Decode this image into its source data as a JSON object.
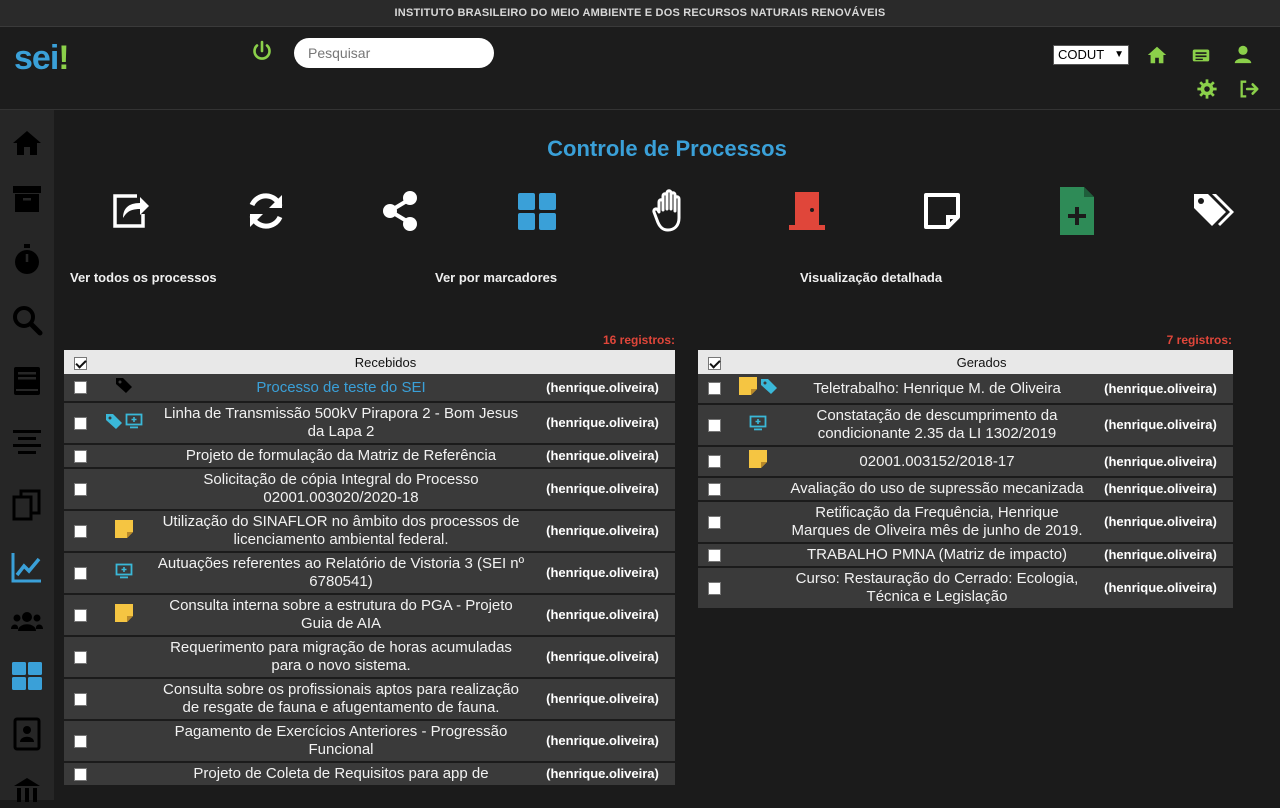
{
  "topbar": {
    "institution": "INSTITUTO BRASILEIRO DO MEIO AMBIENTE E DOS RECURSOS NATURAIS RENOVÁVEIS"
  },
  "header": {
    "logo_text": "sei",
    "logo_mark": "!",
    "search_placeholder": "Pesquisar",
    "unit_selected": "CODUT",
    "icons": [
      "power-icon",
      "home-icon",
      "list-icon",
      "user-icon",
      "gear-icon",
      "logout-icon"
    ]
  },
  "colors": {
    "accent_blue": "#3aa0d8",
    "accent_green": "#8bd04a",
    "alert_red": "#e0463a",
    "note_yellow": "#f5c542",
    "doc_green": "#2e8b57"
  },
  "sidebar": {
    "icons": [
      "home-icon",
      "archive-icon",
      "stopwatch-icon",
      "search-icon",
      "book-icon",
      "align-icon",
      "copy-icon",
      "chart-icon",
      "users-icon",
      "grid-icon",
      "contacts-icon",
      "building-icon"
    ]
  },
  "main": {
    "title": "Controle de Processos",
    "actions": [
      "share-out-icon",
      "refresh-icon",
      "share-nodes-icon",
      "panels-icon",
      "hand-icon",
      "door-icon",
      "note-icon",
      "new-doc-icon",
      "tags-icon"
    ],
    "filters": {
      "all": "Ver todos os processos",
      "markers": "Ver por marcadores",
      "detailed": "Visualização detalhada"
    },
    "received": {
      "count": "16 registros:",
      "header": "Recebidos",
      "rows": [
        {
          "title": "Processo de teste do SEI",
          "user": "(henrique.oliveira)",
          "icons": [
            "tag-dark"
          ],
          "link": true
        },
        {
          "title": "Linha de Transmissão 500kV Pirapora 2 - Bom Jesus da Lapa 2",
          "user": "(henrique.oliveira)",
          "icons": [
            "tag-blue",
            "monitor"
          ]
        },
        {
          "title": "Projeto de formulação da Matriz de Referência",
          "user": "(henrique.oliveira)",
          "icons": []
        },
        {
          "title": "Solicitação de cópia Integral do Processo 02001.003020/2020-18",
          "user": "(henrique.oliveira)",
          "icons": []
        },
        {
          "title": "Utilização do SINAFLOR no âmbito dos processos de licenciamento ambiental federal.",
          "user": "(henrique.oliveira)",
          "icons": [
            "note"
          ]
        },
        {
          "title": "Autuações referentes ao Relatório de Vistoria 3 (SEI nº 6780541)",
          "user": "(henrique.oliveira)",
          "icons": [
            "monitor"
          ]
        },
        {
          "title": "Consulta interna sobre a estrutura do PGA - Projeto Guia de AIA",
          "user": "(henrique.oliveira)",
          "icons": [
            "note"
          ]
        },
        {
          "title": "Requerimento para migração de horas acumuladas para o novo sistema.",
          "user": "(henrique.oliveira)",
          "icons": []
        },
        {
          "title": "Consulta sobre os profissionais aptos para realização de resgate de fauna e afugentamento de fauna.",
          "user": "(henrique.oliveira)",
          "icons": []
        },
        {
          "title": "Pagamento de Exercícios Anteriores - Progressão Funcional",
          "user": "(henrique.oliveira)",
          "icons": []
        },
        {
          "title": "Projeto de Coleta de Requisitos para app de",
          "user": "(henrique.oliveira)",
          "icons": []
        }
      ]
    },
    "generated": {
      "count": "7 registros:",
      "header": "Gerados",
      "rows": [
        {
          "title": "Teletrabalho: Henrique M. de Oliveira",
          "user": "(henrique.oliveira)",
          "icons": [
            "note",
            "tag-blue"
          ]
        },
        {
          "title": "Constatação de descumprimento da condicionante 2.35 da LI 1302/2019",
          "user": "(henrique.oliveira)",
          "icons": [
            "monitor"
          ]
        },
        {
          "title": "02001.003152/2018-17",
          "user": "(henrique.oliveira)",
          "icons": [
            "note"
          ]
        },
        {
          "title": "Avaliação do uso de supressão mecanizada",
          "user": "(henrique.oliveira)",
          "icons": []
        },
        {
          "title": "Retificação da Frequência, Henrique Marques de Oliveira mês de junho de 2019.",
          "user": "(henrique.oliveira)",
          "icons": []
        },
        {
          "title": "TRABALHO PMNA (Matriz de impacto)",
          "user": "(henrique.oliveira)",
          "icons": []
        },
        {
          "title": "Curso: Restauração do Cerrado: Ecologia, Técnica e Legislação",
          "user": "(henrique.oliveira)",
          "icons": []
        }
      ]
    }
  }
}
